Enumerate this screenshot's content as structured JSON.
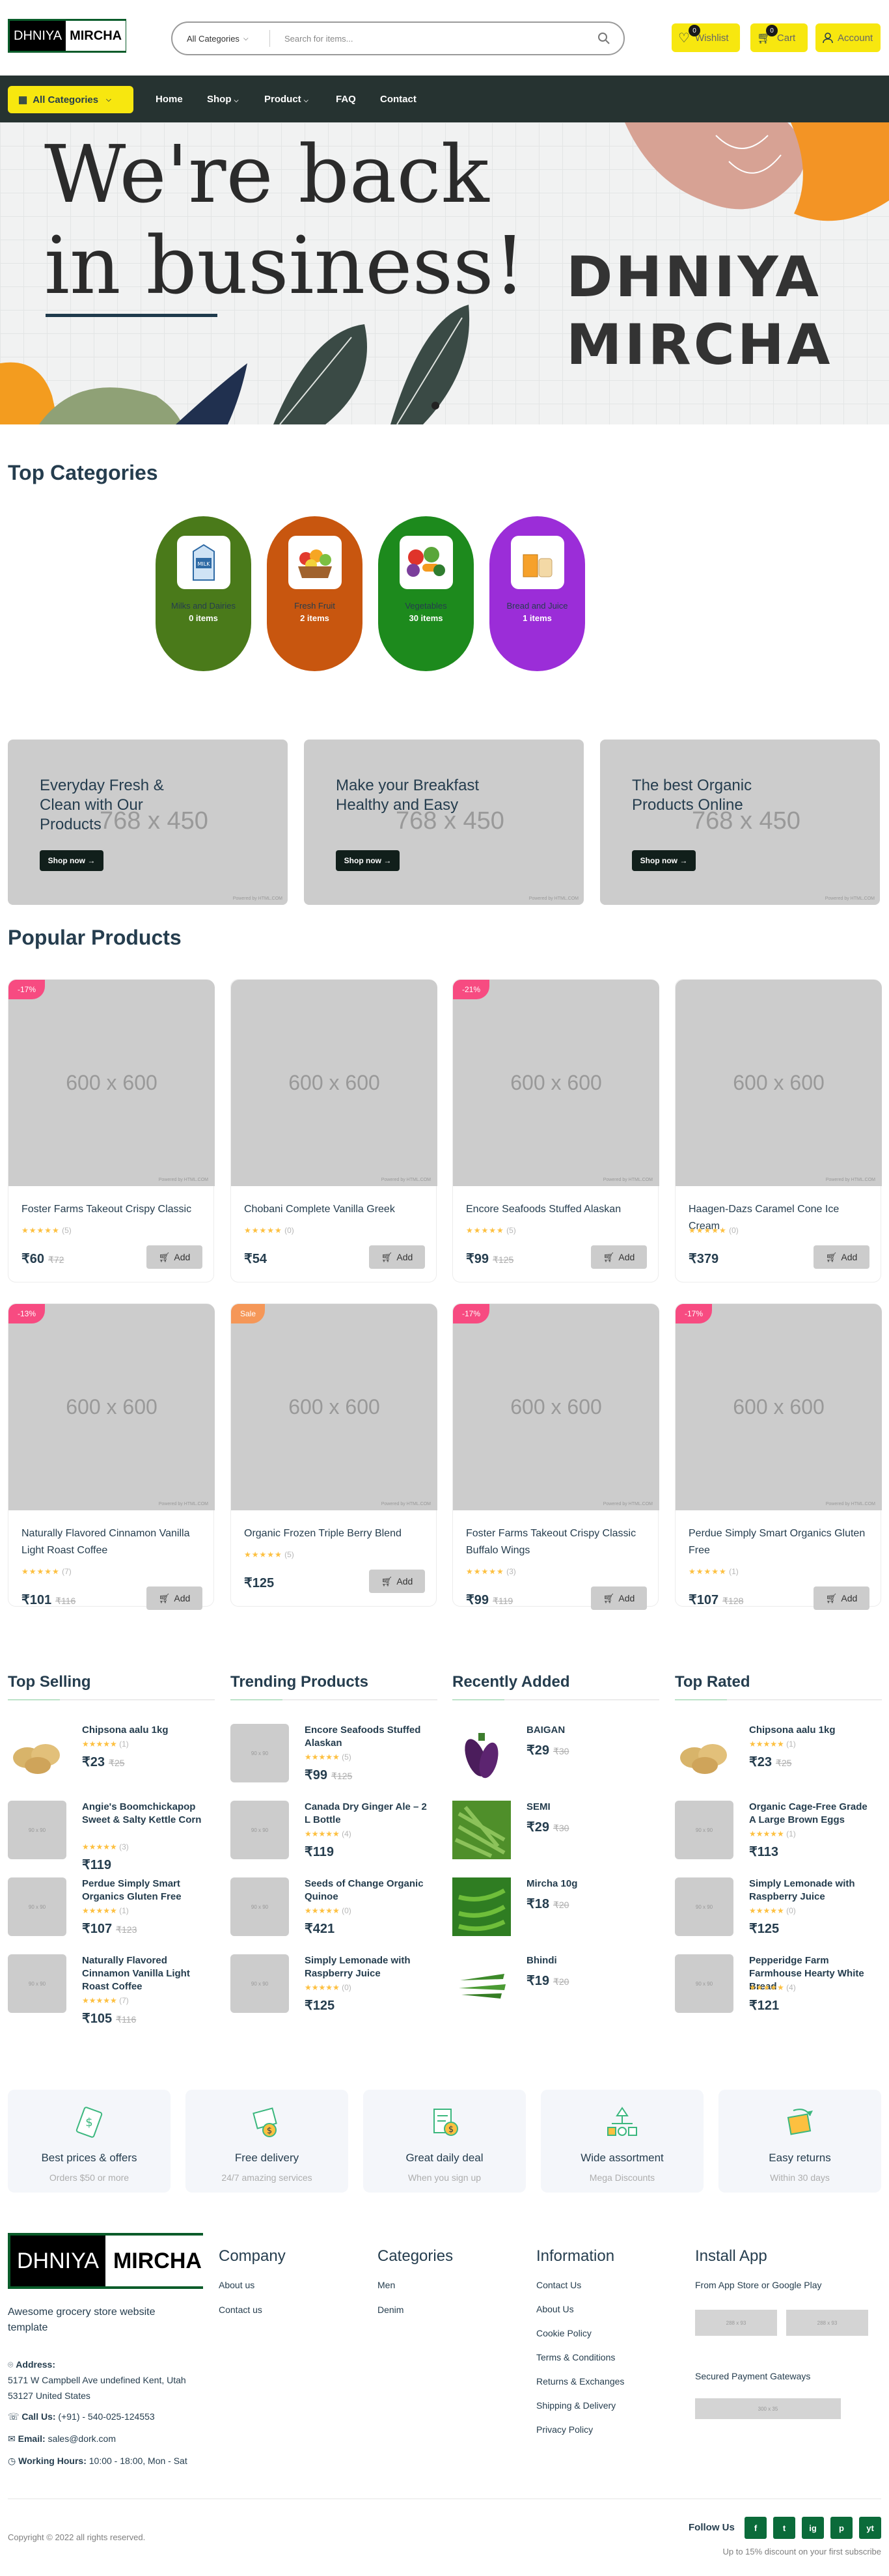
{
  "header": {
    "logo_part1": "DHNIYA",
    "logo_part2": "MIRCHA",
    "search_category": "All Categories",
    "search_placeholder": "Search for items...",
    "wishlist_label": "Wishlist",
    "wishlist_count": "0",
    "cart_label": "Cart",
    "cart_count": "0",
    "account_label": "Account"
  },
  "nav": {
    "all_categories": "All Categories",
    "items": [
      "Home",
      "Shop",
      "Product",
      "FAQ",
      "Contact"
    ]
  },
  "hero": {
    "headline_line1": "We're back",
    "headline_line2": "in business!",
    "brand_line1": "DHNIYA",
    "brand_line2": "MIRCHA"
  },
  "top_categories": {
    "title": "Top Categories",
    "items": [
      {
        "name": "Milks and Dairies",
        "count": "0 items",
        "color": "#4a7a1a"
      },
      {
        "name": "Fresh Fruit",
        "count": "2 items",
        "color": "#c8560f"
      },
      {
        "name": "Vegetables",
        "count": "30 items",
        "color": "#1d8a1d"
      },
      {
        "name": "Bread and Juice",
        "count": "1 items",
        "color": "#9b2dd8"
      }
    ]
  },
  "banners": [
    {
      "title": "Everyday Fresh & Clean with Our Products",
      "placeholder": "768 x 450",
      "button": "Shop now",
      "credit": "Powered by HTML.COM"
    },
    {
      "title": "Make your Breakfast Healthy and Easy",
      "placeholder": "768 x 450",
      "button": "Shop now",
      "credit": "Powered by HTML.COM"
    },
    {
      "title": "The best Organic Products Online",
      "placeholder": "768 x 450",
      "button": "Shop now",
      "credit": "Powered by HTML.COM"
    }
  ],
  "popular": {
    "title": "Popular Products",
    "add_label": "Add",
    "placeholder": "600 x 600",
    "credit": "Powered by HTML.COM",
    "products": [
      {
        "name": "Foster Farms Takeout Crispy Classic",
        "tag": "-17%",
        "tag_color": "#f74b81",
        "stars": "★★★★★",
        "reviews": "(5)",
        "price": "₹60",
        "old": "₹72"
      },
      {
        "name": "Chobani Complete Vanilla Greek",
        "tag": "",
        "tag_color": "",
        "stars": "★★★★★",
        "reviews": "(0)",
        "price": "₹54",
        "old": ""
      },
      {
        "name": "Encore Seafoods Stuffed Alaskan",
        "tag": "-21%",
        "tag_color": "#f74b81",
        "stars": "★★★★★",
        "reviews": "(5)",
        "price": "₹99",
        "old": "₹125"
      },
      {
        "name": "Haagen-Dazs Caramel Cone Ice Cream",
        "tag": "",
        "tag_color": "",
        "stars": "★★★★★",
        "reviews": "(0)",
        "price": "₹379",
        "old": ""
      },
      {
        "name": "Naturally Flavored Cinnamon Vanilla Light Roast Coffee",
        "tag": "-13%",
        "tag_color": "#f74b81",
        "stars": "★★★★★",
        "reviews": "(7)",
        "price": "₹101",
        "old": "₹116"
      },
      {
        "name": "Organic Frozen Triple Berry Blend",
        "tag": "Sale",
        "tag_color": "#f59758",
        "stars": "★★★★★",
        "reviews": "(5)",
        "price": "₹125",
        "old": ""
      },
      {
        "name": "Foster Farms Takeout Crispy Classic Buffalo Wings",
        "tag": "-17%",
        "tag_color": "#f74b81",
        "stars": "★★★★★",
        "reviews": "(3)",
        "price": "₹99",
        "old": "₹119"
      },
      {
        "name": "Perdue Simply Smart Organics Gluten Free",
        "tag": "-17%",
        "tag_color": "#f74b81",
        "stars": "★★★★★",
        "reviews": "(1)",
        "price": "₹107",
        "old": "₹128"
      }
    ]
  },
  "lists": {
    "placeholder": "90 x 90",
    "columns": [
      {
        "title": "Top Selling",
        "items": [
          {
            "name": "Chipsona aalu 1kg",
            "stars": "★★★★★",
            "reviews": "(1)",
            "price": "₹23",
            "old": "₹25",
            "img": "potato"
          },
          {
            "name": "Angie's Boomchickapop Sweet & Salty Kettle Corn",
            "stars": "★★★★★",
            "reviews": "(3)",
            "price": "₹119",
            "old": "",
            "img": ""
          },
          {
            "name": "Perdue Simply Smart Organics Gluten Free",
            "stars": "★★★★★",
            "reviews": "(1)",
            "price": "₹107",
            "old": "₹123",
            "img": ""
          },
          {
            "name": "Naturally Flavored Cinnamon Vanilla Light Roast Coffee",
            "stars": "★★★★★",
            "reviews": "(7)",
            "price": "₹105",
            "old": "₹116",
            "img": ""
          }
        ]
      },
      {
        "title": "Trending Products",
        "items": [
          {
            "name": "Encore Seafoods Stuffed Alaskan",
            "stars": "★★★★★",
            "reviews": "(5)",
            "price": "₹99",
            "old": "₹125",
            "img": ""
          },
          {
            "name": "Canada Dry Ginger Ale – 2 L Bottle",
            "stars": "★★★★★",
            "reviews": "(4)",
            "price": "₹119",
            "old": "",
            "img": ""
          },
          {
            "name": "Seeds of Change Organic Quinoe",
            "stars": "★★★★★",
            "reviews": "(0)",
            "price": "₹421",
            "old": "",
            "img": ""
          },
          {
            "name": "Simply Lemonade with Raspberry Juice",
            "stars": "★★★★★",
            "reviews": "(0)",
            "price": "₹125",
            "old": "",
            "img": ""
          }
        ]
      },
      {
        "title": "Recently Added",
        "items": [
          {
            "name": "BAIGAN",
            "stars": "",
            "reviews": "",
            "price": "₹29",
            "old": "₹30",
            "img": "eggplant"
          },
          {
            "name": "SEMI",
            "stars": "",
            "reviews": "",
            "price": "₹29",
            "old": "₹30",
            "img": "beans"
          },
          {
            "name": "Mircha 10g",
            "stars": "",
            "reviews": "",
            "price": "₹18",
            "old": "₹20",
            "img": "chili"
          },
          {
            "name": "Bhindi",
            "stars": "",
            "reviews": "",
            "price": "₹19",
            "old": "₹20",
            "img": "okra"
          }
        ]
      },
      {
        "title": "Top Rated",
        "items": [
          {
            "name": "Chipsona aalu 1kg",
            "stars": "★★★★★",
            "reviews": "(1)",
            "price": "₹23",
            "old": "₹25",
            "img": "potato"
          },
          {
            "name": "Organic Cage-Free Grade A Large Brown Eggs",
            "stars": "★★★★★",
            "reviews": "(1)",
            "price": "₹113",
            "old": "",
            "img": ""
          },
          {
            "name": "Simply Lemonade with Raspberry Juice",
            "stars": "★★★★★",
            "reviews": "(0)",
            "price": "₹125",
            "old": "",
            "img": ""
          },
          {
            "name": "Pepperidge Farm Farmhouse Hearty White Bread",
            "stars": "★★★★★",
            "reviews": "(4)",
            "price": "₹121",
            "old": "",
            "img": ""
          }
        ]
      }
    ]
  },
  "features": [
    {
      "title": "Best prices & offers",
      "sub": "Orders $50 or more"
    },
    {
      "title": "Free delivery",
      "sub": "24/7 amazing services"
    },
    {
      "title": "Great daily deal",
      "sub": "When you sign up"
    },
    {
      "title": "Wide assortment",
      "sub": "Mega Discounts"
    },
    {
      "title": "Easy returns",
      "sub": "Within 30 days"
    }
  ],
  "footer": {
    "tagline": "Awesome grocery store website template",
    "address_label": "Address:",
    "address": "5171 W Campbell Ave undefined Kent, Utah 53127 United States",
    "call_label": "Call Us:",
    "call": "(+91) - 540-025-124553",
    "email_label": "Email:",
    "email": "sales@dork.com",
    "hours_label": "Working Hours:",
    "hours": "10:00 - 18:00, Mon - Sat",
    "company_title": "Company",
    "company_links": [
      "About us",
      "Contact us"
    ],
    "categories_title": "Categories",
    "categories_links": [
      "Men",
      "Denim"
    ],
    "info_title": "Information",
    "info_links": [
      "Contact Us",
      "About Us",
      "Cookie Policy",
      "Terms & Conditions",
      "Returns & Exchanges",
      "Shipping & Delivery",
      "Privacy Policy"
    ],
    "install_title": "Install App",
    "install_sub": "From App Store or Google Play",
    "app_placeholder": "288 x 93",
    "payment_label": "Secured Payment Gateways",
    "payment_placeholder": "300 x 35",
    "copyright": "Copyright © 2022 all rights reserved.",
    "follow": "Follow Us",
    "social": [
      "f",
      "t",
      "ig",
      "p",
      "yt"
    ],
    "discount": "Up to 15% discount on your first subscribe"
  }
}
